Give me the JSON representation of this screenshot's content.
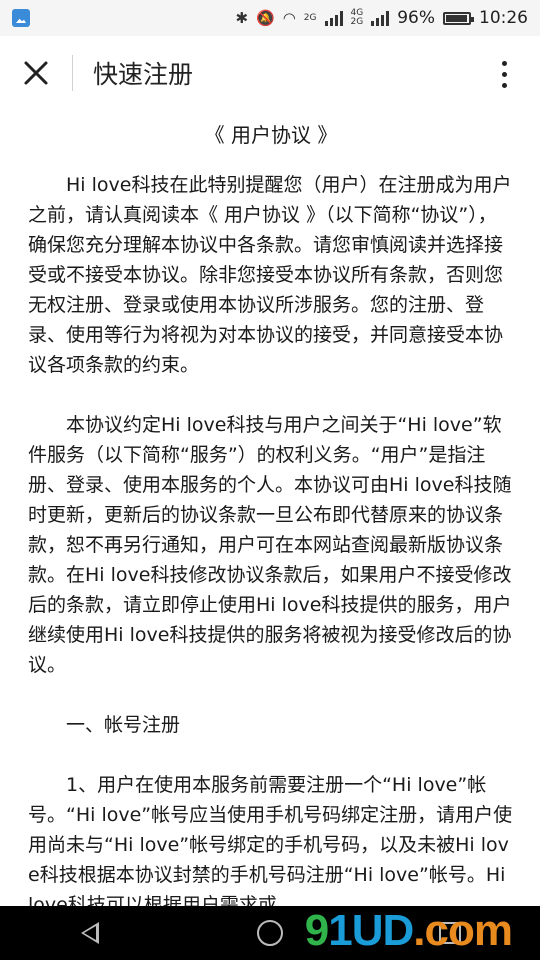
{
  "statusbar": {
    "battery": "96%",
    "battery_level": 0.96,
    "time": "10:26",
    "net_top": "4G",
    "net_bottom": "2G",
    "sim2": "2G"
  },
  "header": {
    "title": "快速注册"
  },
  "doc": {
    "title": "《 用户协议 》",
    "p1": "Hi love科技在此特别提醒您（用户）在注册成为用户之前，请认真阅读本《 用户协议 》（以下简称“协议”），确保您充分理解本协议中各条款。请您审慎阅读并选择接受或不接受本协议。除非您接受本协议所有条款，否则您无权注册、登录或使用本协议所涉服务。您的注册、登录、使用等行为将视为对本协议的接受，并同意接受本协议各项条款的约束。",
    "p2": "本协议约定Hi love科技与用户之间关于“Hi love”软件服务（以下简称“服务”）的权利义务。“用户”是指注册、登录、使用本服务的个人。本协议可由Hi love科技随时更新，更新后的协议条款一旦公布即代替原来的协议条款，恕不再另行通知，用户可在本网站查阅最新版协议条款。在Hi love科技修改协议条款后，如果用户不接受修改后的条款，请立即停止使用Hi love科技提供的服务，用户继续使用Hi love科技提供的服务将被视为接受修改后的协议。",
    "section1": "一、帐号注册",
    "p3": "1、用户在使用本服务前需要注册一个“Hi love”帐号。“Hi love”帐号应当使用手机号码绑定注册，请用户使用尚未与“Hi love”帐号绑定的手机号码，以及未被Hi love科技根据本协议封禁的手机号码注册“Hi love”帐号。Hi love科技可以根据用户需求或"
  },
  "watermark": {
    "part1": "9",
    "part2": "1UD",
    "part3": ".com"
  }
}
